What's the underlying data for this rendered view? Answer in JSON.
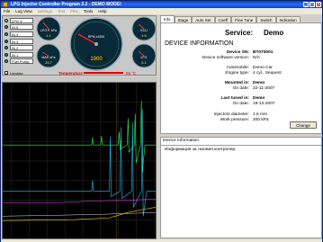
{
  "window": {
    "title": "LPG Injector Controller Program 2.2 - DEMO MODE!",
    "menu": [
      "File",
      "Log View",
      "Settings",
      "Test",
      "Flex",
      "Tools",
      "Help"
    ]
  },
  "inputs": [
    {
      "label": "LPG V",
      "on": true
    },
    {
      "label": "IN 5",
      "on": false
    },
    {
      "label": "IN 4",
      "on": false
    },
    {
      "label": "IN 3",
      "on": false
    },
    {
      "label": "IN 2",
      "on": false
    },
    {
      "label": "IN 1",
      "on": false
    },
    {
      "label": "Fuel Pump",
      "on": false
    }
  ],
  "lambda_label": "Lambda",
  "gauges": {
    "lpg_pressure": {
      "label": "LPG P, kPa",
      "value": "1.1"
    },
    "map": {
      "label": "MAP, kPa",
      "value": "25.7"
    },
    "rpm": {
      "label": "RPM x1000",
      "value": "1900"
    },
    "ecu": {
      "label": "ECU",
      "value": "4.5"
    },
    "lpg": {
      "label": "LPG",
      "value": "5.1"
    }
  },
  "temperature": {
    "label": "Temperature",
    "value": "65 °C"
  },
  "tabs": [
    "Info",
    "Stage",
    "Auto Set",
    "Coeff",
    "Fine Tune",
    "Switch",
    "Indication"
  ],
  "active_tab": "Info",
  "service": {
    "key": "Service:",
    "value": "Demo"
  },
  "device_info_heading": "DEVICE INFORMATION",
  "info_rows": [
    {
      "key": "Device SN:",
      "value": "BT070001",
      "bold": true
    },
    {
      "key": "Device software version:",
      "value": "N/A",
      "bold": false
    },
    {
      "key": "Automobile:",
      "value": "Demo Car",
      "bold": false
    },
    {
      "key": "Engine type:",
      "value": "4 cyl., Sequent",
      "bold": false
    },
    {
      "key": "Mounted in:",
      "value": "Demo",
      "bold": true
    },
    {
      "key": "On date:",
      "value": "22-11-2007",
      "bold": false
    },
    {
      "key": "Last tuned in:",
      "value": "Demo",
      "bold": true
    },
    {
      "key": "On date:",
      "value": "19-12-2007",
      "bold": false
    },
    {
      "key": "Injectors diameter:",
      "value": "1.6 mm",
      "bold": false
    },
    {
      "key": "Work pressure:",
      "value": "200 kPa",
      "bold": false
    }
  ],
  "change_button": "Change",
  "description": {
    "title": "Device Information",
    "text": "Информация за газовия контролер."
  }
}
